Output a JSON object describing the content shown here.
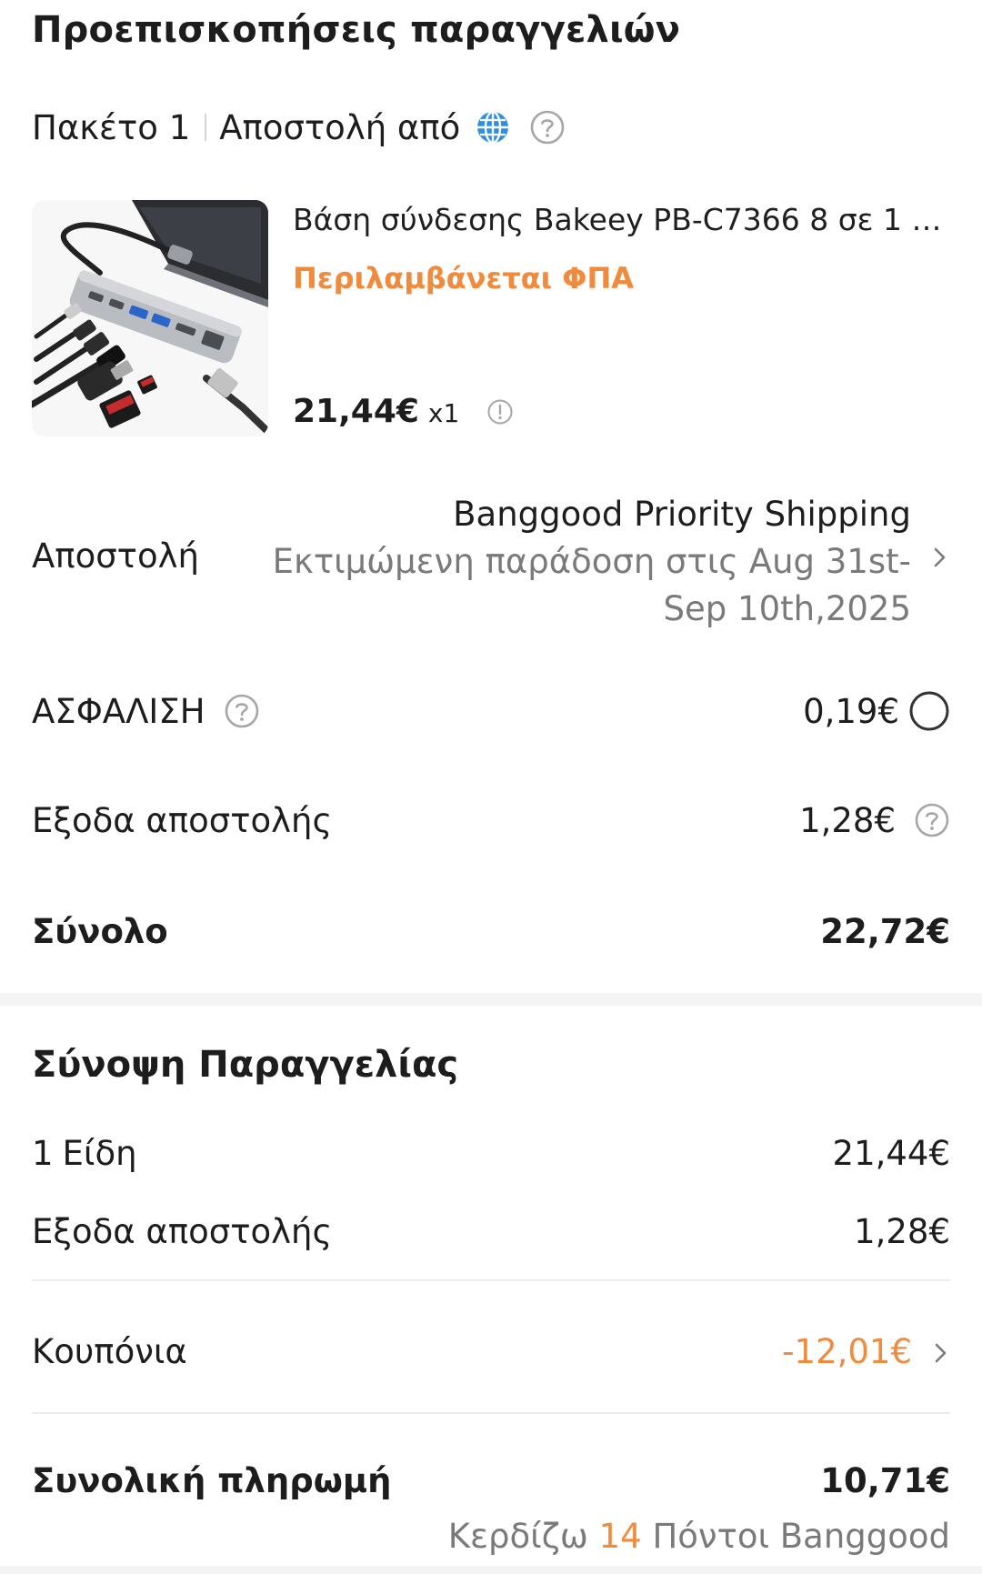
{
  "order_preview": {
    "title": "Προεπισκοπήσεις παραγγελιών",
    "package": {
      "label": "Πακέτο 1",
      "ships_from_label": "Αποστολή από",
      "globe_icon": "globe-icon",
      "help_icon": "help-icon"
    },
    "product": {
      "image_alt": "USB-C hub product image",
      "title": "Βάση σύνδεσης Bakeey PB-C7366 8 σε 1 με ...",
      "vat_note": "Περιλαμβάνεται ΦΠΑ",
      "price": "21,44€",
      "quantity": "x1",
      "info_icon": "info-icon"
    },
    "shipping": {
      "label": "Αποστολή",
      "method": "Banggood Priority Shipping",
      "eta_line1": "Εκτιμώμενη παράδοση στις Aug 31st-",
      "eta_line2": "Sep 10th,2025",
      "chevron_icon": "chevron-right-icon"
    },
    "insurance": {
      "label": "ΑΣΦΑΛΙΣΗ",
      "value": "0,19€",
      "selected": false
    },
    "shipping_cost": {
      "label": "Εξοδα αποστολής",
      "value": "1,28€"
    },
    "subtotal": {
      "label": "Σύνολο",
      "value": "22,72€"
    }
  },
  "order_summary": {
    "title": "Σύνοψη Παραγγελίας",
    "items_count": "1",
    "items_label": "Είδη",
    "items_value": "21,44€",
    "shipping_label": "Εξοδα αποστολής",
    "shipping_value": "1,28€",
    "coupons_label": "Κουπόνια",
    "coupons_value": "-12,01€",
    "total_label": "Συνολική πληρωμή",
    "total_value": "10,71€",
    "earn_prefix": "Κερδίζω",
    "earn_points": "14",
    "earn_suffix": "Πόντοι Banggood"
  },
  "colors": {
    "accent_orange": "#f08a3c",
    "muted_gray": "#7a7a7a",
    "globe_blue": "#2f8fe8"
  }
}
